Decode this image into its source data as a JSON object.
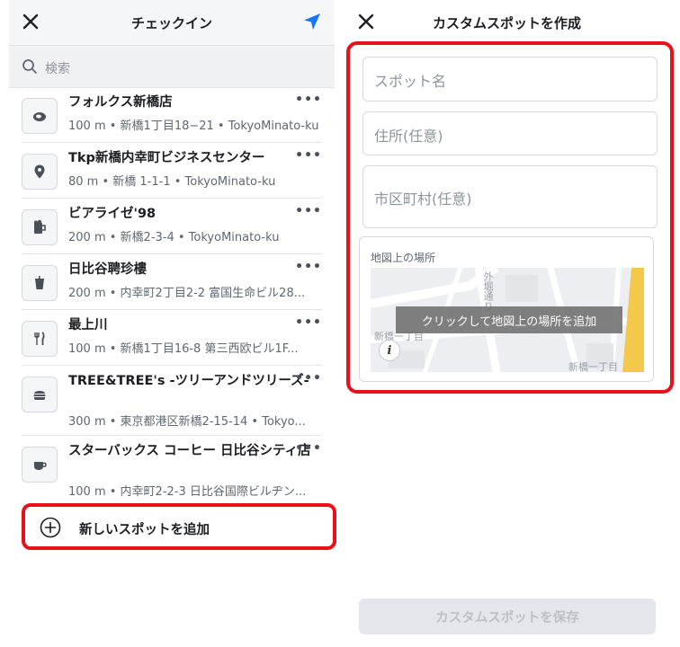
{
  "checkin": {
    "title": "チェックイン",
    "search_placeholder": "検索",
    "more_label": "•••",
    "items": [
      {
        "name": "フォルクス新橋店",
        "sub": "100 m • 新橋1丁目18−21 • TokyoMinato-ku",
        "icon": "steak-icon"
      },
      {
        "name": "Tkp新橋内幸町ビジネスセンター",
        "sub": "80 m • 新橋 1-1-1 • TokyoMinato-ku",
        "icon": "location-pin-icon"
      },
      {
        "name": "ビアライゼ'98",
        "sub": "200 m • 新橋2-3-4 • TokyoMinato-ku",
        "icon": "beer-mug-icon"
      },
      {
        "name": "日比谷聘珍樓",
        "sub": "200 m • 内幸町2丁目2-2 富国生命ビル28...",
        "icon": "cup-icon"
      },
      {
        "name": "最上川",
        "sub": "100 m • 新橋1丁目16-8 第三西欧ビル1F...",
        "icon": "fork-knife-icon"
      },
      {
        "name": "TREE&TREE's -ツリーアンドツリーズ-",
        "sub": "300 m • 東京都港区新橋2-15-14 • Tokyo...",
        "icon": "burger-icon"
      },
      {
        "name": "スターバックス コーヒー 日比谷シティ店",
        "sub": "100 m • 内幸町2-2-3 日比谷国際ビルヂン...",
        "icon": "coffee-cup-icon"
      }
    ],
    "add_spot_label": "新しいスポットを追加"
  },
  "custom_spot": {
    "title": "カスタムスポットを作成",
    "spot_name_placeholder": "スポット名",
    "address_placeholder": "住所(任意)",
    "city_placeholder": "市区町村(任意)",
    "map_label": "地図上の場所",
    "map_overlay_text": "クリックして地図上の場所を追加",
    "map_street_label": "新橋一丁目",
    "map_corner_label": "新橋一丁目",
    "map_vertical_label": "外堀通り",
    "map_info_label": "i",
    "save_label": "カスタムスポットを保存"
  },
  "colors": {
    "accent_blue": "#1877f2",
    "highlight_red": "#e8101b",
    "disabled_bg": "#e4e6eb",
    "disabled_text": "#bcc0c4"
  }
}
